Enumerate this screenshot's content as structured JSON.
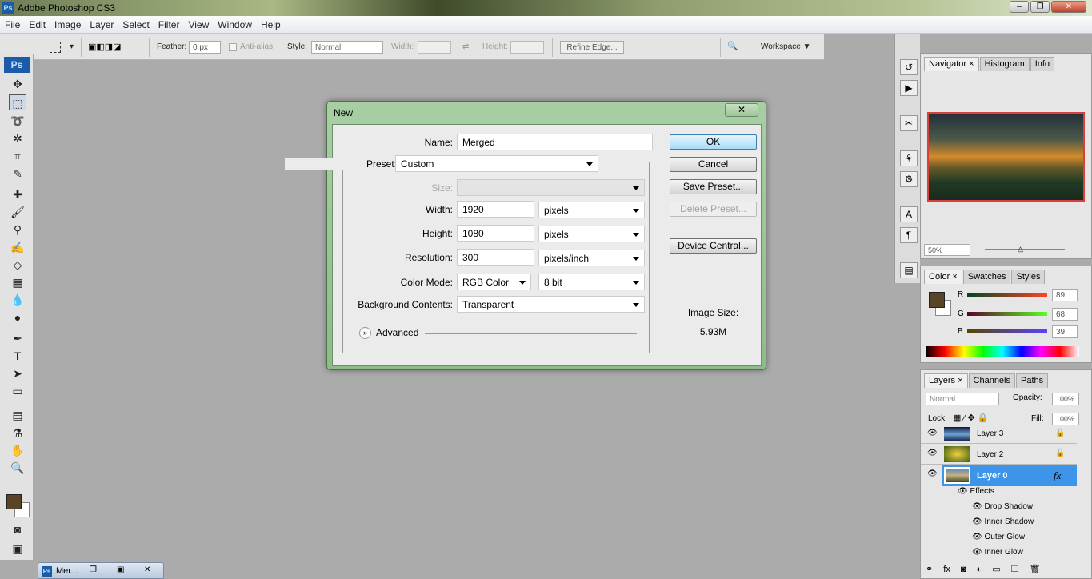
{
  "app": {
    "title": "Adobe Photoshop CS3",
    "icon": "Ps"
  },
  "menu": [
    "File",
    "Edit",
    "Image",
    "Layer",
    "Select",
    "Filter",
    "View",
    "Window",
    "Help"
  ],
  "options": {
    "feather_label": "Feather:",
    "feather_value": "0 px",
    "antialias": "Anti-alias",
    "style_label": "Style:",
    "style_value": "Normal",
    "width_label": "Width:",
    "height_label": "Height:",
    "refine_edge": "Refine Edge...",
    "workspace": "Workspace ▼"
  },
  "dialog": {
    "title": "New",
    "name_label": "Name:",
    "name_value": "Merged",
    "preset_label": "Preset:",
    "preset_value": "Custom",
    "size_label": "Size:",
    "width_label": "Width:",
    "width_value": "1920",
    "width_unit": "pixels",
    "height_label": "Height:",
    "height_value": "1080",
    "height_unit": "pixels",
    "resolution_label": "Resolution:",
    "resolution_value": "300",
    "resolution_unit": "pixels/inch",
    "colormode_label": "Color Mode:",
    "colormode_value": "RGB Color",
    "bitdepth_value": "8 bit",
    "bg_label": "Background Contents:",
    "bg_value": "Transparent",
    "advanced": "Advanced",
    "buttons": {
      "ok": "OK",
      "cancel": "Cancel",
      "save": "Save Preset...",
      "delete": "Delete Preset...",
      "device": "Device Central..."
    },
    "image_size_label": "Image Size:",
    "image_size_value": "5.93M"
  },
  "navigator": {
    "tabs": [
      "Navigator",
      "Histogram",
      "Info"
    ],
    "zoom": "50%"
  },
  "color": {
    "tabs": [
      "Color",
      "Swatches",
      "Styles"
    ],
    "r": "89",
    "g": "68",
    "b": "39",
    "r_label": "R",
    "g_label": "G",
    "b_label": "B",
    "foreground": "#594427"
  },
  "layers": {
    "tabs": [
      "Layers",
      "Channels",
      "Paths"
    ],
    "blend": "Normal",
    "opacity_label": "Opacity:",
    "opacity": "100%",
    "lock_label": "Lock:",
    "fill_label": "Fill:",
    "fill": "100%",
    "items": [
      "Layer 3",
      "Layer 2",
      "Layer 0"
    ],
    "effects_label": "Effects",
    "effects": [
      "Drop Shadow",
      "Inner Shadow",
      "Outer Glow",
      "Inner Glow"
    ]
  },
  "taskbar": {
    "doc": "Mer..."
  },
  "accent": "#3d95ea"
}
